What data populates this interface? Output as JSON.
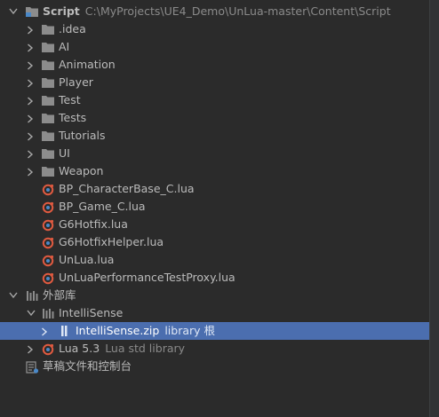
{
  "project": {
    "name": "Script",
    "path": "C:\\MyProjects\\UE4_Demo\\UnLua-master\\Content\\Script"
  },
  "folders": [
    {
      "label": ".idea"
    },
    {
      "label": "AI"
    },
    {
      "label": "Animation"
    },
    {
      "label": "Player"
    },
    {
      "label": "Test"
    },
    {
      "label": "Tests"
    },
    {
      "label": "Tutorials"
    },
    {
      "label": "UI"
    },
    {
      "label": "Weapon"
    }
  ],
  "files": [
    {
      "label": "BP_CharacterBase_C.lua"
    },
    {
      "label": "BP_Game_C.lua"
    },
    {
      "label": "G6Hotfix.lua"
    },
    {
      "label": "G6HotfixHelper.lua"
    },
    {
      "label": "UnLua.lua"
    },
    {
      "label": "UnLuaPerformanceTestProxy.lua"
    }
  ],
  "external_libraries": {
    "label": "外部库",
    "intellisense": {
      "label": "IntelliSense",
      "zip": {
        "label": "IntelliSense.zip",
        "suffix": "library 根"
      }
    },
    "lua": {
      "label": "Lua 5.3",
      "suffix": "Lua std library"
    }
  },
  "scratches": {
    "label": "草稿文件和控制台"
  },
  "colors": {
    "background": "#2b2b2b",
    "selection": "#4b6eaf",
    "folder": "#8c8c8c",
    "text": "#bbbbbb",
    "lua_file": "#e05a40"
  }
}
